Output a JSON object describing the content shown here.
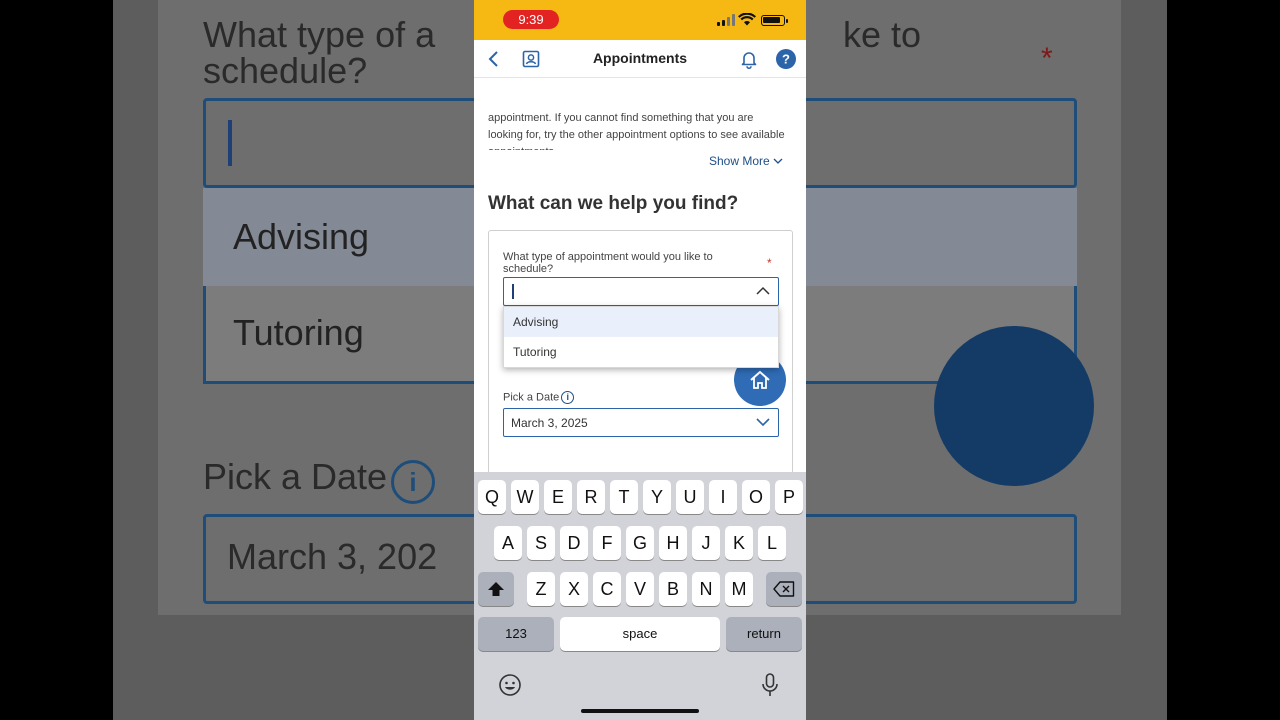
{
  "status_bar": {
    "time": "9:39"
  },
  "nav": {
    "title": "Appointments"
  },
  "intro": {
    "text": "appointment. If you cannot find something that you are looking for, try the other appointment options to see available appointments.",
    "show_more": "Show More"
  },
  "section": {
    "title": "What can we help you find?"
  },
  "form": {
    "type_label": "What type of appointment would you like to schedule?",
    "required_mark": "*",
    "type_value": "",
    "options": [
      "Advising",
      "Tutoring"
    ],
    "date_label": "Pick a Date",
    "date_info": "i",
    "date_value": "March 3, 2025"
  },
  "keyboard": {
    "row1": [
      "Q",
      "W",
      "E",
      "R",
      "T",
      "Y",
      "U",
      "I",
      "O",
      "P"
    ],
    "row2": [
      "A",
      "S",
      "D",
      "F",
      "G",
      "H",
      "J",
      "K",
      "L"
    ],
    "row3": [
      "Z",
      "X",
      "C",
      "V",
      "B",
      "N",
      "M"
    ],
    "numbers_label": "123",
    "space_label": "space",
    "return_label": "return"
  },
  "background": {
    "question": "What type of a",
    "question_tail": "ke to",
    "question_line2": "schedule?",
    "star": "*",
    "opt1": "Advising",
    "opt2": "Tutoring",
    "date_label": "Pick a Date",
    "date_info": "i",
    "date_value": "March 3, 202"
  },
  "colors": {
    "status_bar": "#f6b812",
    "time_pill": "#e32322",
    "brand_blue": "#2f6cb5",
    "link": "#1e4f86"
  }
}
